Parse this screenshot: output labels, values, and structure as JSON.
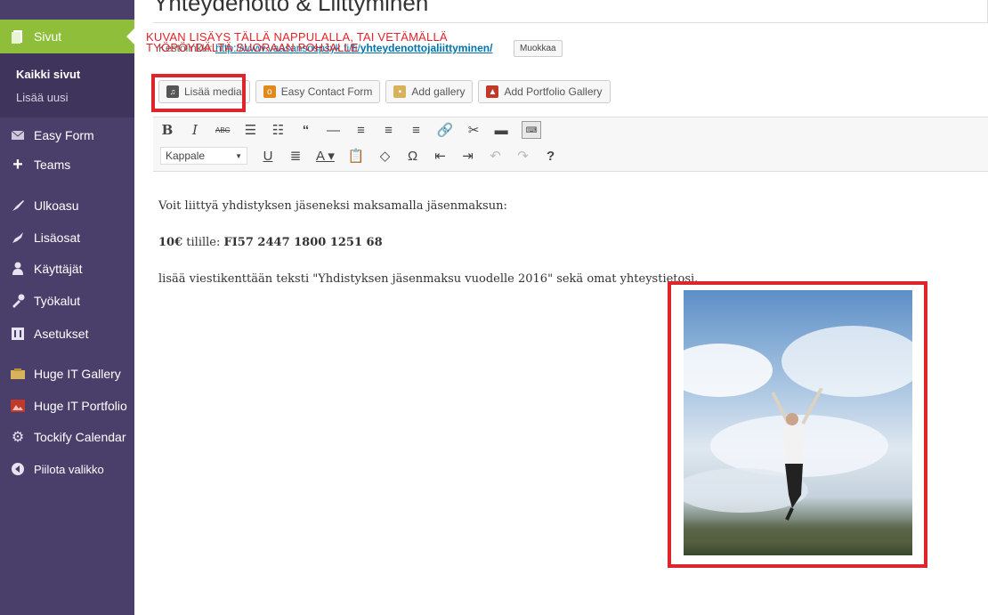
{
  "sidebar": {
    "active": {
      "label": "Sivut",
      "icon": "pages-icon"
    },
    "submenu": [
      {
        "label": "Kaikki sivut"
      },
      {
        "label": "Lisää uusi"
      }
    ],
    "items": [
      {
        "label": "Easy Form",
        "icon": "mail-icon"
      },
      {
        "label": "Teams",
        "icon": "plus-icon"
      },
      {
        "label": "Ulkoasu",
        "icon": "brush-icon"
      },
      {
        "label": "Lisäosat",
        "icon": "plugin-icon"
      },
      {
        "label": "Käyttäjät",
        "icon": "user-icon"
      },
      {
        "label": "Työkalut",
        "icon": "wrench-icon"
      },
      {
        "label": "Asetukset",
        "icon": "settings-icon"
      },
      {
        "label": "Huge IT Gallery",
        "icon": "gallery-icon"
      },
      {
        "label": "Huge IT Portfolio",
        "icon": "portfolio-icon"
      },
      {
        "label": "Tockify Calendar",
        "icon": "gear-icon"
      },
      {
        "label": "Piilota valikko",
        "icon": "collapse-icon"
      }
    ]
  },
  "editor": {
    "title": "Yhteydenotto & Liittyminen",
    "permalink": {
      "label": "Kestolinkki:",
      "url_base": "http://www.vaasansospsyk.fi/fi/",
      "url_slug": "yhteydenottojaliittyminen/",
      "edit_label": "Muokkaa"
    },
    "annotation": {
      "line1": "KUVAN LISÄYS TÄLLÄ NAPPULALLA, TAI VETÄMÄLLÄ",
      "line2": "TYÖPÖYDÄLTÄ SUORAAN POHJALLE"
    },
    "media_buttons": [
      {
        "label": "Lisää media",
        "icon": "add-media-icon"
      },
      {
        "label": "Easy Contact Form",
        "icon": "contact-form-icon"
      },
      {
        "label": "Add gallery",
        "icon": "gallery-icon"
      },
      {
        "label": "Add Portfolio Gallery",
        "icon": "portfolio-icon"
      }
    ],
    "format_select": "Kappale",
    "content": {
      "p1": "Voit liittyä yhdistyksen jäseneksi maksamalla jäsenmaksun:",
      "p2_amount": "10€",
      "p2_mid": " tilille: ",
      "p2_account": "FI57 2447 1800 1251 68",
      "p3": "lisää viestikenttään teksti \"Yhdistyksen jäsenmaksu vuodelle 2016\" sekä omat yhteystietosi."
    },
    "colors": {
      "sidebar_bg": "#4a3f6a",
      "active_bg": "#8fbf3a",
      "highlight": "#e0242b"
    }
  }
}
